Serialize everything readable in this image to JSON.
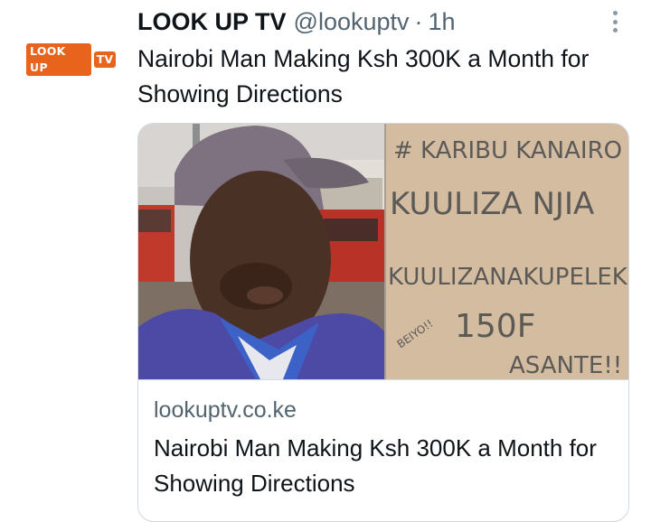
{
  "account": {
    "logo_word1": "LOOK UP",
    "logo_word2": "TV",
    "display_name": "LOOK UP TV",
    "handle": "@lookuptv",
    "separator": "·",
    "time": "1h"
  },
  "tweet": {
    "text": "Nairobi Man Making Ksh 300K a Month for Showing Directions"
  },
  "card": {
    "image_sign": {
      "line1": "# KARIBU KANAIRO",
      "line2": "KUULIZA NJIA",
      "line3": "KUULIZANAKUPELEK",
      "line4": "150F",
      "line5": "ASANTE!!",
      "side": "BEIYO!!"
    },
    "domain": "lookuptv.co.ke",
    "title": "Nairobi Man Making Ksh 300K a Month for Showing Directions"
  },
  "colors": {
    "brand_orange": "#e8641c",
    "secondary_text": "#536471",
    "border": "#cfd9de"
  },
  "icons": {
    "more": "more-vertical-icon"
  }
}
